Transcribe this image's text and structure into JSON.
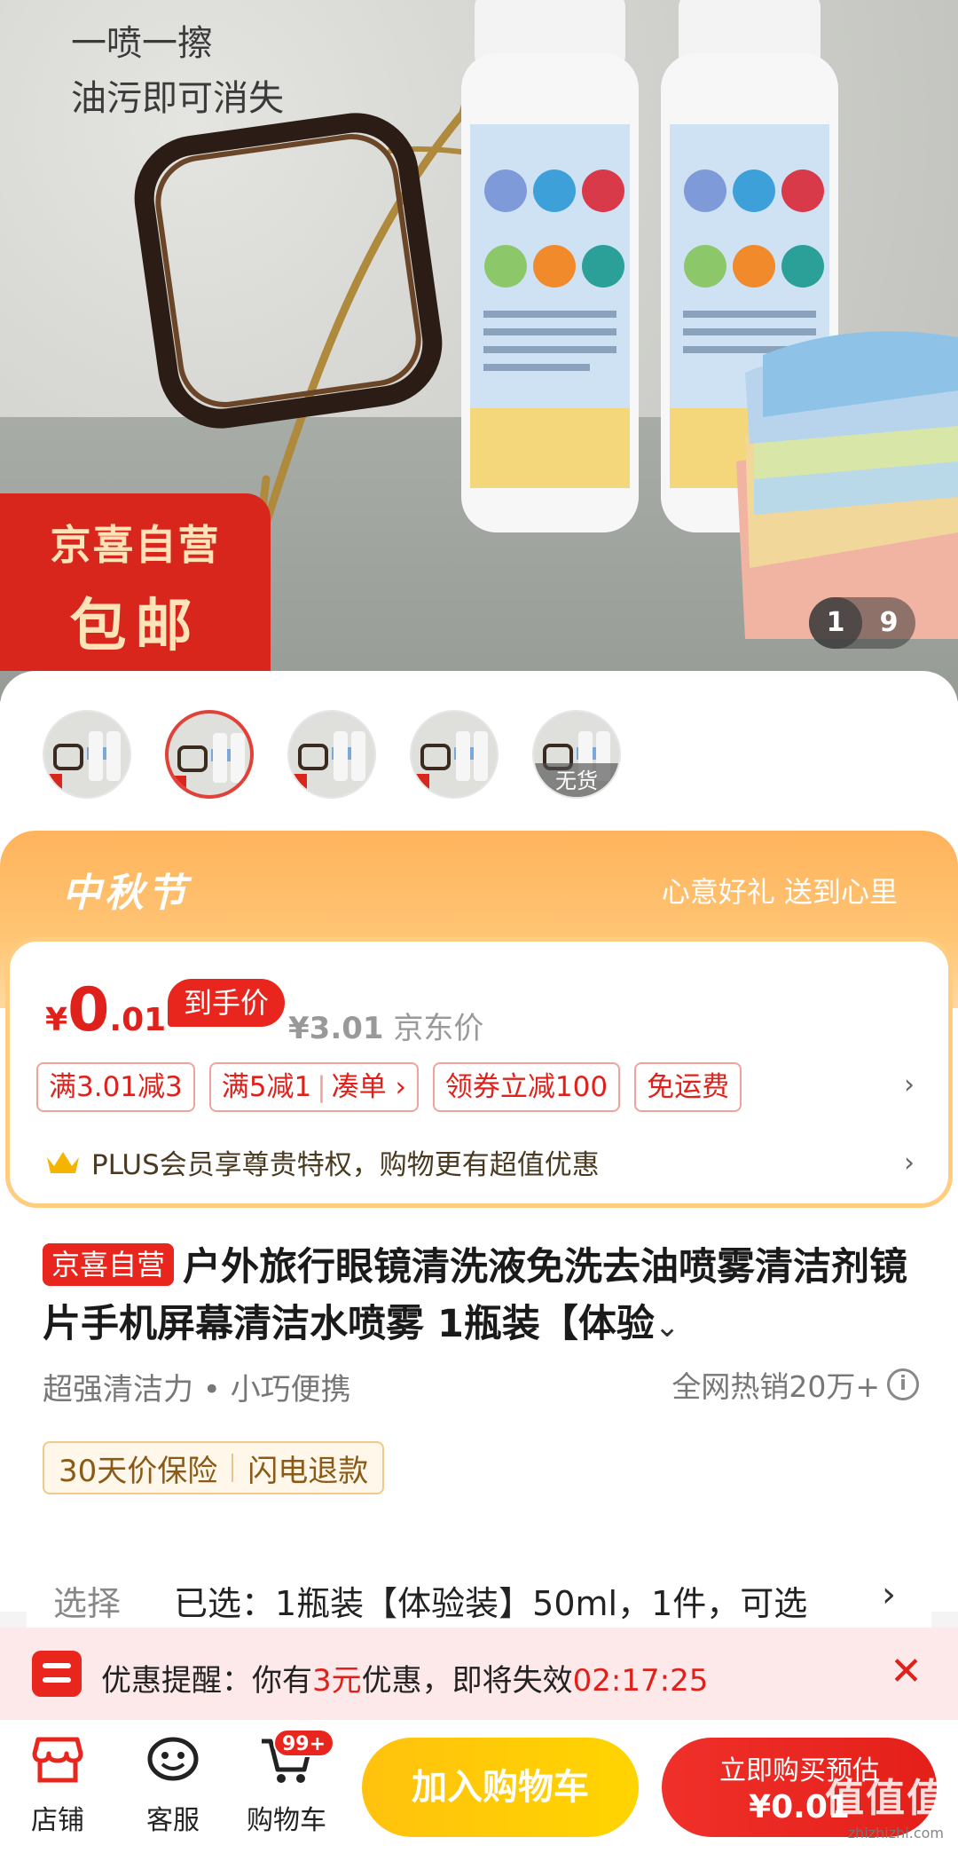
{
  "hero": {
    "caption_line1": "一喷一擦",
    "caption_line2": "油污即可消失",
    "badge_line1": "京喜自营",
    "badge_line2": "包邮",
    "pager_current": "1",
    "pager_total": "9"
  },
  "thumbs": [
    {
      "selected": false,
      "label": ""
    },
    {
      "selected": true,
      "label": ""
    },
    {
      "selected": false,
      "label": ""
    },
    {
      "selected": false,
      "label": ""
    },
    {
      "selected": false,
      "label": "无货"
    }
  ],
  "promo": {
    "title": "中秋节",
    "slogan": "心意好礼 送到心里",
    "price_currency": "¥",
    "price_int": "0",
    "price_dec": ".01",
    "price_tag": "到手价",
    "jd_price": "¥3.01",
    "jd_price_label": "京东价",
    "coupons": [
      "满3.01减3",
      "满5减1",
      "凑单 ›",
      "领券立减100",
      "免运费"
    ],
    "plus_text": "PLUS会员享尊贵特权，购物更有超值优惠"
  },
  "product": {
    "tag": "京喜自营",
    "title": "户外旅行眼镜清洗液免洗去油喷雾清洁剂镜片手机屏幕清洁水喷雾 1瓶装【体验",
    "expand": "⌄",
    "features": "超强清洁力 • 小巧便携",
    "sold": "全网热销20万+",
    "guarantees": [
      "30天价保险",
      "闪电退款"
    ]
  },
  "select": {
    "label": "选择",
    "value": "已选：1瓶装【体验装】50ml，1件，可选",
    "arrow": "›"
  },
  "reminder": {
    "prefix": "优惠提醒：你有",
    "amount": "3元",
    "middle": "优惠，即将失效",
    "countdown": "02:17:25",
    "close": "✕"
  },
  "bottombar": {
    "store_label": "店铺",
    "service_label": "客服",
    "cart_label": "购物车",
    "cart_badge": "99+",
    "add_cart": "加入购物车",
    "buy_line1": "立即购买预估",
    "buy_line2": "¥0.01"
  },
  "watermark": {
    "text": "值值值",
    "sub": "zhizhizhi.com"
  },
  "colors": {
    "accent_red": "#e0211b",
    "promo_orange": "#ffb35c",
    "cart_yellow": "#ffc20e"
  }
}
